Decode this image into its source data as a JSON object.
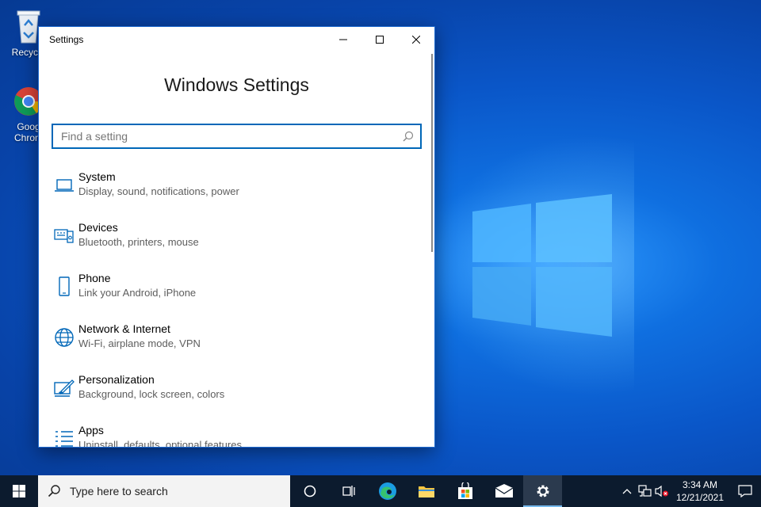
{
  "desktop": {
    "icons": [
      {
        "label": "Recycle",
        "icon": "recycle-bin-icon"
      },
      {
        "label": "Goog Chrom",
        "icon": "chrome-icon"
      }
    ]
  },
  "window": {
    "title": "Settings",
    "heading": "Windows Settings",
    "search_placeholder": "Find a setting",
    "items": [
      {
        "name": "System",
        "desc": "Display, sound, notifications, power",
        "icon": "laptop-icon"
      },
      {
        "name": "Devices",
        "desc": "Bluetooth, printers, mouse",
        "icon": "devices-icon"
      },
      {
        "name": "Phone",
        "desc": "Link your Android, iPhone",
        "icon": "phone-icon"
      },
      {
        "name": "Network & Internet",
        "desc": "Wi-Fi, airplane mode, VPN",
        "icon": "globe-icon"
      },
      {
        "name": "Personalization",
        "desc": "Background, lock screen, colors",
        "icon": "paint-icon"
      },
      {
        "name": "Apps",
        "desc": "Uninstall, defaults, optional features",
        "icon": "apps-list-icon"
      }
    ]
  },
  "taskbar": {
    "search_text": "Type here to search",
    "time": "3:34 AM",
    "date": "12/21/2021"
  },
  "colors": {
    "accent": "#0067b8",
    "taskbar": "#0c1b2e"
  }
}
